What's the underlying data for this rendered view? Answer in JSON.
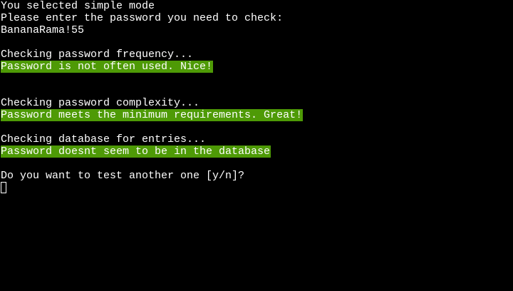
{
  "terminal": {
    "lines": {
      "mode_selected": "You selected simple mode",
      "enter_prompt": "Please enter the password you need to check:",
      "password_input": "BananaRama!55",
      "checking_frequency": "Checking password frequency...",
      "frequency_result": "Password is not often used. Nice!",
      "checking_complexity": "Checking password complexity...",
      "complexity_result": "Password meets the minimum requirements. Great!",
      "checking_database": "Checking database for entries...",
      "database_result": "Password doesnt seem to be in the database",
      "retry_prompt": "Do you want to test another one [y/n]?"
    },
    "colors": {
      "background": "#000000",
      "text": "#ffffff",
      "success_highlight": "#4e9a06"
    }
  }
}
